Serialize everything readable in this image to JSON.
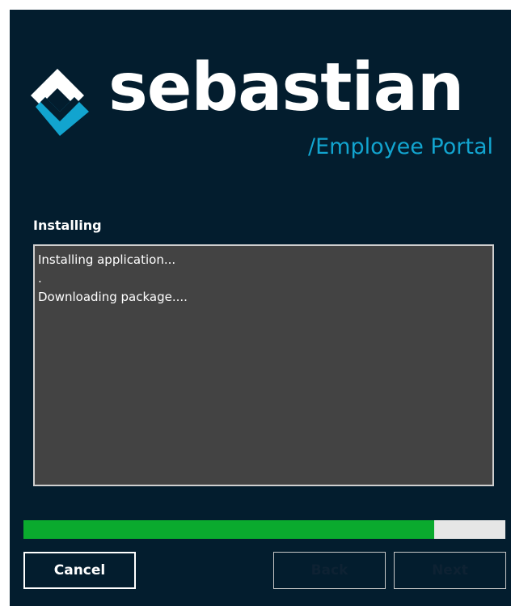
{
  "brand": {
    "name": "sebastian",
    "tagline": "/Employee Portal",
    "accent_color": "#12a4cf",
    "logo_icon": "diamond-chevron-logo-icon"
  },
  "install": {
    "title": "Installing",
    "log_lines": [
      "Installing application...",
      ".",
      "Downloading package...."
    ],
    "progress": 0.853
  },
  "buttons": {
    "cancel": "Cancel",
    "back": "Back",
    "next": "Next"
  },
  "colors": {
    "window_bg": "#031d2e",
    "log_bg": "#434343",
    "progress_fill": "#0aaa2e",
    "progress_track": "#e6e6e6"
  }
}
